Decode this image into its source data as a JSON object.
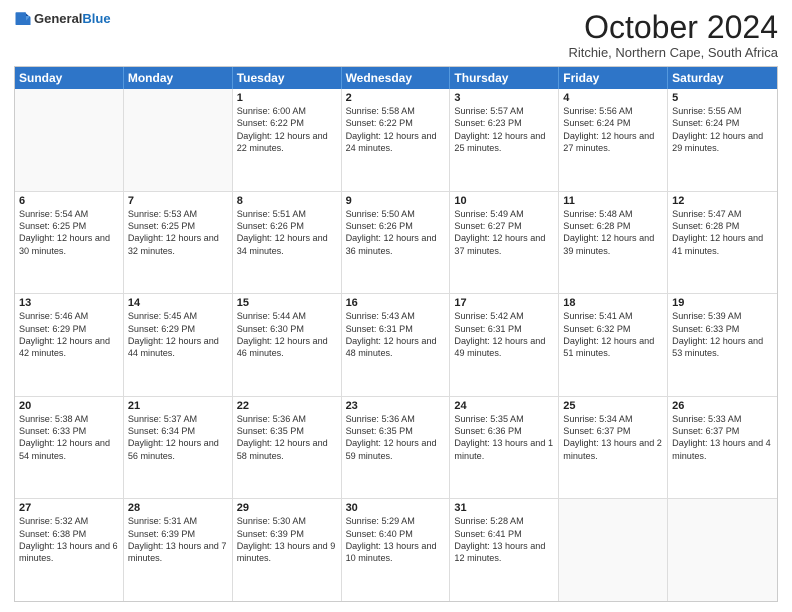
{
  "logo": {
    "general": "General",
    "blue": "Blue"
  },
  "title": "October 2024",
  "location": "Ritchie, Northern Cape, South Africa",
  "header_days": [
    "Sunday",
    "Monday",
    "Tuesday",
    "Wednesday",
    "Thursday",
    "Friday",
    "Saturday"
  ],
  "rows": [
    [
      {
        "day": "",
        "info": ""
      },
      {
        "day": "",
        "info": ""
      },
      {
        "day": "1",
        "info": "Sunrise: 6:00 AM\nSunset: 6:22 PM\nDaylight: 12 hours and 22 minutes."
      },
      {
        "day": "2",
        "info": "Sunrise: 5:58 AM\nSunset: 6:22 PM\nDaylight: 12 hours and 24 minutes."
      },
      {
        "day": "3",
        "info": "Sunrise: 5:57 AM\nSunset: 6:23 PM\nDaylight: 12 hours and 25 minutes."
      },
      {
        "day": "4",
        "info": "Sunrise: 5:56 AM\nSunset: 6:24 PM\nDaylight: 12 hours and 27 minutes."
      },
      {
        "day": "5",
        "info": "Sunrise: 5:55 AM\nSunset: 6:24 PM\nDaylight: 12 hours and 29 minutes."
      }
    ],
    [
      {
        "day": "6",
        "info": "Sunrise: 5:54 AM\nSunset: 6:25 PM\nDaylight: 12 hours and 30 minutes."
      },
      {
        "day": "7",
        "info": "Sunrise: 5:53 AM\nSunset: 6:25 PM\nDaylight: 12 hours and 32 minutes."
      },
      {
        "day": "8",
        "info": "Sunrise: 5:51 AM\nSunset: 6:26 PM\nDaylight: 12 hours and 34 minutes."
      },
      {
        "day": "9",
        "info": "Sunrise: 5:50 AM\nSunset: 6:26 PM\nDaylight: 12 hours and 36 minutes."
      },
      {
        "day": "10",
        "info": "Sunrise: 5:49 AM\nSunset: 6:27 PM\nDaylight: 12 hours and 37 minutes."
      },
      {
        "day": "11",
        "info": "Sunrise: 5:48 AM\nSunset: 6:28 PM\nDaylight: 12 hours and 39 minutes."
      },
      {
        "day": "12",
        "info": "Sunrise: 5:47 AM\nSunset: 6:28 PM\nDaylight: 12 hours and 41 minutes."
      }
    ],
    [
      {
        "day": "13",
        "info": "Sunrise: 5:46 AM\nSunset: 6:29 PM\nDaylight: 12 hours and 42 minutes."
      },
      {
        "day": "14",
        "info": "Sunrise: 5:45 AM\nSunset: 6:29 PM\nDaylight: 12 hours and 44 minutes."
      },
      {
        "day": "15",
        "info": "Sunrise: 5:44 AM\nSunset: 6:30 PM\nDaylight: 12 hours and 46 minutes."
      },
      {
        "day": "16",
        "info": "Sunrise: 5:43 AM\nSunset: 6:31 PM\nDaylight: 12 hours and 48 minutes."
      },
      {
        "day": "17",
        "info": "Sunrise: 5:42 AM\nSunset: 6:31 PM\nDaylight: 12 hours and 49 minutes."
      },
      {
        "day": "18",
        "info": "Sunrise: 5:41 AM\nSunset: 6:32 PM\nDaylight: 12 hours and 51 minutes."
      },
      {
        "day": "19",
        "info": "Sunrise: 5:39 AM\nSunset: 6:33 PM\nDaylight: 12 hours and 53 minutes."
      }
    ],
    [
      {
        "day": "20",
        "info": "Sunrise: 5:38 AM\nSunset: 6:33 PM\nDaylight: 12 hours and 54 minutes."
      },
      {
        "day": "21",
        "info": "Sunrise: 5:37 AM\nSunset: 6:34 PM\nDaylight: 12 hours and 56 minutes."
      },
      {
        "day": "22",
        "info": "Sunrise: 5:36 AM\nSunset: 6:35 PM\nDaylight: 12 hours and 58 minutes."
      },
      {
        "day": "23",
        "info": "Sunrise: 5:36 AM\nSunset: 6:35 PM\nDaylight: 12 hours and 59 minutes."
      },
      {
        "day": "24",
        "info": "Sunrise: 5:35 AM\nSunset: 6:36 PM\nDaylight: 13 hours and 1 minute."
      },
      {
        "day": "25",
        "info": "Sunrise: 5:34 AM\nSunset: 6:37 PM\nDaylight: 13 hours and 2 minutes."
      },
      {
        "day": "26",
        "info": "Sunrise: 5:33 AM\nSunset: 6:37 PM\nDaylight: 13 hours and 4 minutes."
      }
    ],
    [
      {
        "day": "27",
        "info": "Sunrise: 5:32 AM\nSunset: 6:38 PM\nDaylight: 13 hours and 6 minutes."
      },
      {
        "day": "28",
        "info": "Sunrise: 5:31 AM\nSunset: 6:39 PM\nDaylight: 13 hours and 7 minutes."
      },
      {
        "day": "29",
        "info": "Sunrise: 5:30 AM\nSunset: 6:39 PM\nDaylight: 13 hours and 9 minutes."
      },
      {
        "day": "30",
        "info": "Sunrise: 5:29 AM\nSunset: 6:40 PM\nDaylight: 13 hours and 10 minutes."
      },
      {
        "day": "31",
        "info": "Sunrise: 5:28 AM\nSunset: 6:41 PM\nDaylight: 13 hours and 12 minutes."
      },
      {
        "day": "",
        "info": ""
      },
      {
        "day": "",
        "info": ""
      }
    ]
  ]
}
